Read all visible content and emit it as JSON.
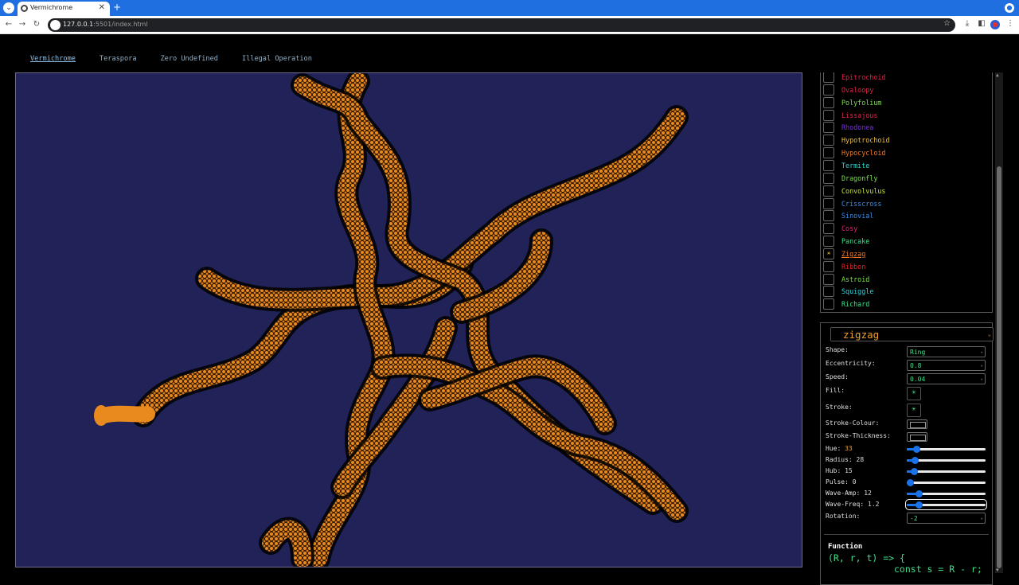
{
  "browser": {
    "tab_title": "Vermichrome",
    "tab_menu_icon": "⌄",
    "close_glyph": "✕",
    "new_tab_glyph": "+",
    "url_host": "127.0.0.1",
    "url_rest": ":5501/index.html",
    "back_glyph": "←",
    "forward_glyph": "→",
    "reload_glyph": "↻",
    "star_glyph": "☆",
    "download_glyph": "⤓",
    "sidepanel_glyph": "◧",
    "menu_glyph": "⋮"
  },
  "nav": {
    "items": [
      "Vermichrome",
      "Teraspora",
      "Zero Undefined",
      "Illegal Operation"
    ],
    "active": 0
  },
  "curves": [
    {
      "label": "Epitrochoid",
      "color": "#e0244a",
      "checked": false
    },
    {
      "label": "Ovaloopy",
      "color": "#e0244a",
      "checked": false
    },
    {
      "label": "Polyfolium",
      "color": "#7be04a",
      "checked": false
    },
    {
      "label": "Lissajous",
      "color": "#e0244a",
      "checked": false
    },
    {
      "label": "Rhodonea",
      "color": "#7a2ed8",
      "checked": false
    },
    {
      "label": "Hypotrochoid",
      "color": "#f0c040",
      "checked": false
    },
    {
      "label": "Hypocycloid",
      "color": "#f07a28",
      "checked": false
    },
    {
      "label": "Termite",
      "color": "#30d8d0",
      "checked": false
    },
    {
      "label": "Dragonfly",
      "color": "#7be04a",
      "checked": false
    },
    {
      "label": "Convolvulus",
      "color": "#c8e040",
      "checked": false
    },
    {
      "label": "Crisscross",
      "color": "#3a8ee8",
      "checked": false
    },
    {
      "label": "Sinovial",
      "color": "#3a8ee8",
      "checked": false
    },
    {
      "label": "Cosy",
      "color": "#e0247a",
      "checked": false
    },
    {
      "label": "Pancake",
      "color": "#3ee08a",
      "checked": false
    },
    {
      "label": "Zigzag",
      "color": "#f07a28",
      "checked": true
    },
    {
      "label": "Ribbon",
      "color": "#e02424",
      "checked": false
    },
    {
      "label": "Astroid",
      "color": "#7be04a",
      "checked": false
    },
    {
      "label": "Squiggle",
      "color": "#30d8e0",
      "checked": false
    },
    {
      "label": "Richard",
      "color": "#3ee08a",
      "checked": false
    }
  ],
  "checked_glyph": "☀",
  "controls": {
    "preset": "zigzag",
    "shape_label": "Shape:",
    "shape": "Ring",
    "eccentricity_label": "Eccentricity:",
    "eccentricity": "0.8",
    "speed_label": "Speed:",
    "speed": "0.04",
    "fill_label": "Fill:",
    "stroke_label": "Stroke:",
    "toggle_glyph": "☀",
    "stroke_colour_label": "Stroke-Colour:",
    "stroke_thickness_label": "Stroke-Thickness:",
    "hue_label": "Hue:",
    "hue": "33",
    "hue_level": 0.09,
    "radius_label": "Radius:",
    "radius": "28",
    "radius_level": 0.07,
    "hub_label": "Hub:",
    "hub": "15",
    "hub_level": 0.05,
    "pulse_label": "Pulse:",
    "pulse": "0",
    "pulse_level": 0.0,
    "wave_amp_label": "Wave-Amp:",
    "wave_amp": "12",
    "wave_amp_level": 0.12,
    "wave_freq_label": "Wave-Freq:",
    "wave_freq": "1.2",
    "wave_freq_level": 0.12,
    "rotation_label": "Rotation:",
    "rotation": "-2",
    "chevron": "⌄"
  },
  "function": {
    "title": "Function",
    "line1": "(R, r, t) => {",
    "line2": "const s = R - r;"
  },
  "colors": {
    "canvas_bg": "#212358",
    "worm": "#e88a1e",
    "accent_green": "#3ee08a"
  }
}
